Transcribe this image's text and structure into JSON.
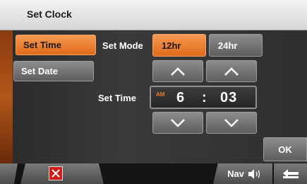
{
  "title": "Set Clock",
  "tabs": {
    "set_time": "Set Time",
    "set_date": "Set Date"
  },
  "mode": {
    "label": "Set Mode",
    "option_12": "12hr",
    "option_24": "24hr",
    "selected": "12hr"
  },
  "time": {
    "label": "Set Time",
    "ampm": "AM",
    "hour": "6",
    "separator": ":",
    "minute": "03"
  },
  "buttons": {
    "ok": "OK",
    "nav": "Nav"
  },
  "icons": {
    "up": "chevron-up-icon",
    "down": "chevron-down-icon",
    "cancel": "close-icon",
    "volume": "speaker-icon",
    "back": "back-arrow-icon"
  },
  "colors": {
    "accent": "#e97a2b",
    "cancel": "#d11c1c"
  }
}
